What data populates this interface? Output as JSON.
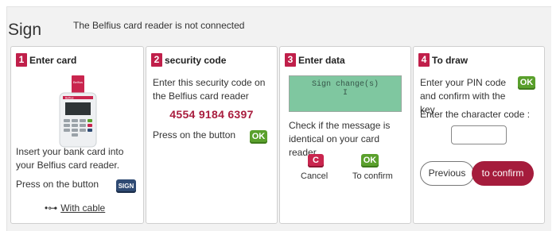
{
  "header": {
    "title": "Sign",
    "status": "The Belfius card reader is not connected"
  },
  "steps": [
    {
      "number": "1",
      "title": "Enter card",
      "card_logo": "Belfius",
      "instruction": "Insert your bank card into your Belfius card reader.",
      "press_label": "Press on the button",
      "sign_key": "SIGN",
      "cable_link": "With cable",
      "cable_icon": "usb-icon"
    },
    {
      "number": "2",
      "title": "security code",
      "instruction": "Enter this security code on the Belfius card reader",
      "security_code": "4554 9184 6397",
      "press_label": "Press on the button",
      "ok_key": "OK"
    },
    {
      "number": "3",
      "title": "Enter data",
      "lcd_line1": "Sign change(s)",
      "lcd_line2": "I",
      "instruction": "Check if the message is identical on your card reader.",
      "cancel_key": "C",
      "cancel_label": "Cancel",
      "ok_key": "OK",
      "confirm_label": "To confirm"
    },
    {
      "number": "4",
      "title": "To draw",
      "instruction": "Enter your PIN code and confirm with the key",
      "ok_key": "OK",
      "code_label": "Enter the character code :",
      "code_value": "",
      "previous_button": "Previous",
      "confirm_button": "to confirm"
    }
  ],
  "colors": {
    "accent": "#c01f4a",
    "ok_green": "#5aa02c",
    "sign_blue": "#2f4a73",
    "lcd_green": "#7fc7a0"
  }
}
